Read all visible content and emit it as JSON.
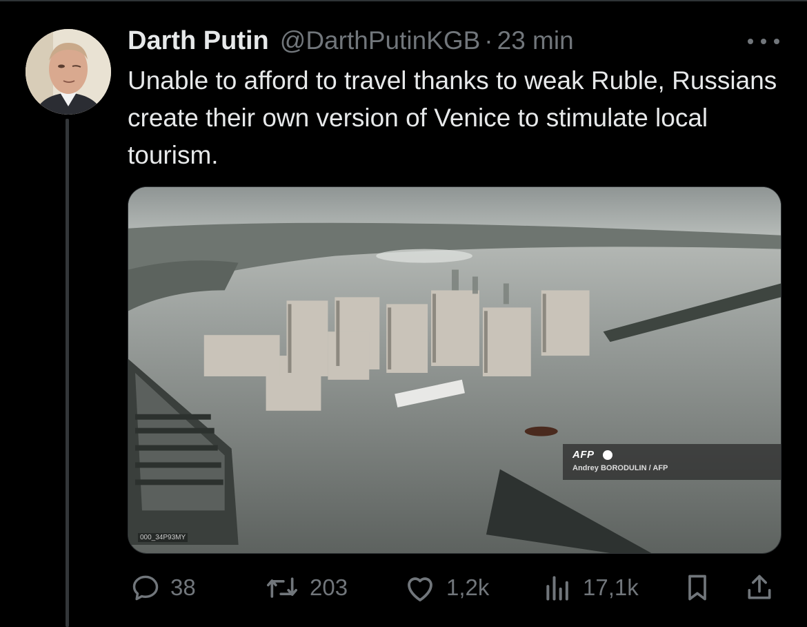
{
  "tweet": {
    "display_name": "Darth Putin",
    "handle": "@DarthPutinKGB",
    "separator": "·",
    "time": "23 min",
    "text": "Unable to afford to travel thanks to weak Ruble, Russians create their own version of Venice to stimulate local tourism."
  },
  "media": {
    "credit_logo": "AFP",
    "credit_text": "Andrey BORODULIN / AFP",
    "image_id": "000_34P93MY"
  },
  "actions": {
    "reply_count": "38",
    "retweet_count": "203",
    "like_count": "1,2k",
    "views_count": "17,1k"
  },
  "icons": {
    "reply": "reply-icon",
    "retweet": "retweet-icon",
    "like": "heart-icon",
    "views": "views-icon",
    "bookmark": "bookmark-icon",
    "share": "share-icon",
    "more": "more-icon"
  },
  "colors": {
    "background": "#000000",
    "text_primary": "#e7e9ea",
    "text_secondary": "#71767b"
  }
}
